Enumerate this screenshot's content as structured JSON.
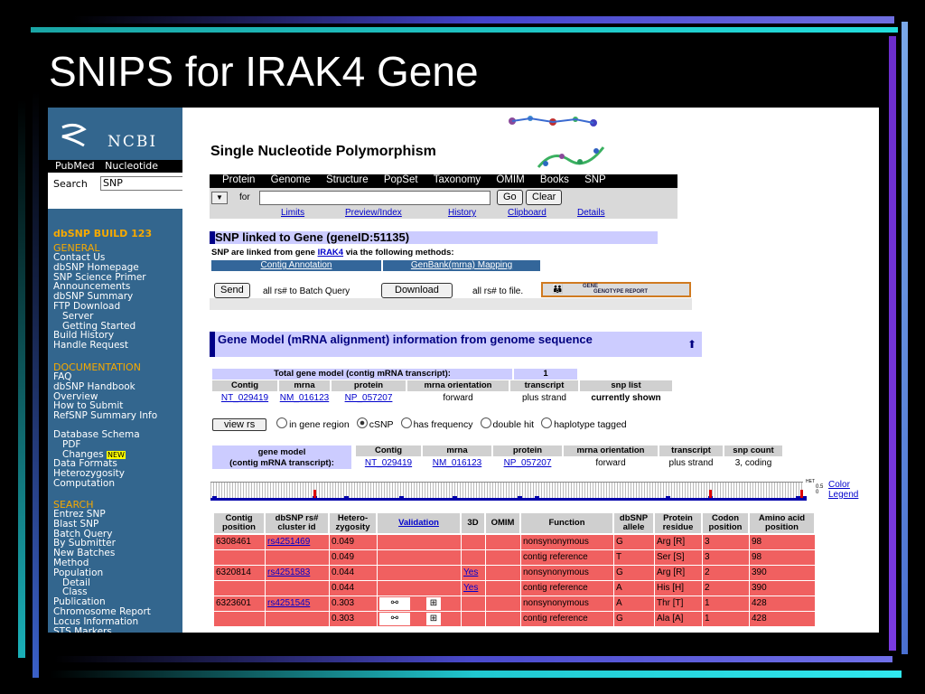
{
  "slide": {
    "title": "SNIPS for IRAK4 Gene"
  },
  "sidebar": {
    "logo": "NCBI",
    "top_links": [
      "PubMed",
      "Nucleotide"
    ],
    "search_label": "Search",
    "search_value": "SNP",
    "build": "dbSNP BUILD 123",
    "general_head": "GENERAL",
    "general": [
      "Contact Us",
      "dbSNP Homepage",
      "SNP Science Primer",
      "Announcements",
      "dbSNP Summary",
      "FTP Download",
      "Server",
      "Getting Started",
      "Build History",
      "Handle Request"
    ],
    "doc_head": "DOCUMENTATION",
    "docs": [
      "FAQ",
      "dbSNP Handbook",
      "Overview",
      "How to Submit",
      "RefSNP Summary Info",
      "Database Schema",
      "PDF",
      "Changes",
      "Data Formats",
      "Heterozygosity",
      "Computation"
    ],
    "new_badge": "NEW",
    "search_head": "SEARCH",
    "searches": [
      "Entrez SNP",
      "Blast SNP",
      "Batch Query",
      "By Submitter",
      "New Batches",
      "Method",
      "Population",
      "Detail",
      "Class",
      "Publication",
      "Chromosome Report",
      "Locus Information",
      "STS Markers"
    ]
  },
  "page": {
    "title": "Single Nucleotide Polymorphism",
    "nav": [
      "Protein",
      "Genome",
      "Structure",
      "PopSet",
      "Taxonomy",
      "OMIM",
      "Books",
      "SNP"
    ],
    "for_label": "for",
    "go": "Go",
    "clear": "Clear",
    "links": [
      "Limits",
      "Preview/Index",
      "History",
      "Clipboard",
      "Details"
    ]
  },
  "linked": {
    "heading": "SNP linked to Gene (geneID:51135)",
    "text_pre": "SNP are linked from gene ",
    "gene": "IRAK4",
    "text_post": " via the following methods:",
    "methods": [
      "Contig Annotation",
      "GenBank(mrna) Mapping"
    ],
    "send": "Send",
    "send_text": "all rs# to Batch Query",
    "download": "Download",
    "download_text": "all rs# to file.",
    "report_top": "GENE",
    "report_bottom": "GENOTYPE REPORT"
  },
  "gene_model": {
    "title": "Gene Model (mRNA alignment) information from genome sequence",
    "up": "⬆",
    "total_label": "Total gene model (contig mRNA transcript):",
    "total_value": "1",
    "headers": [
      "Contig",
      "mrna",
      "protein",
      "mrna orientation",
      "transcript",
      "snp list"
    ],
    "row": [
      "NT_029419",
      "NM_016123",
      "NP_057207",
      "forward",
      "plus strand",
      "currently shown"
    ]
  },
  "filters": {
    "view": "view rs",
    "options": [
      "in gene region",
      "cSNP",
      "has frequency",
      "double hit",
      "haplotype tagged"
    ],
    "selected": "cSNP"
  },
  "gene_model2": {
    "label1": "gene model",
    "label2": "(contig mRNA transcript):",
    "headers": [
      "Contig",
      "mrna",
      "protein",
      "mrna orientation",
      "transcript",
      "snp count"
    ],
    "row": [
      "NT_029419",
      "NM_016123",
      "NP_057207",
      "forward",
      "plus strand",
      "3, coding"
    ]
  },
  "track": {
    "ticks": [
      "HET",
      "0.5",
      "0"
    ],
    "legend1": "Color",
    "legend2": "Legend"
  },
  "snp_table": {
    "headers": [
      [
        "Contig",
        "position"
      ],
      [
        "dbSNP rs#",
        "cluster id"
      ],
      [
        "Hetero-",
        "zygosity"
      ],
      [
        "Validation",
        ""
      ],
      [
        "3D",
        ""
      ],
      [
        "OMIM",
        ""
      ],
      [
        "Function",
        ""
      ],
      [
        "dbSNP",
        "allele"
      ],
      [
        "Protein",
        "residue"
      ],
      [
        "Codon",
        "position"
      ],
      [
        "Amino acid",
        "position"
      ]
    ],
    "rows": [
      [
        "6308461",
        "rs4251469",
        "0.049",
        "",
        "",
        "",
        "nonsynonymous",
        "G",
        "Arg [R]",
        "3",
        "98"
      ],
      [
        "",
        "",
        "0.049",
        "",
        "",
        "",
        "contig reference",
        "T",
        "Ser [S]",
        "3",
        "98"
      ],
      [
        "6320814",
        "rs4251583",
        "0.044",
        "",
        "Yes",
        "",
        "nonsynonymous",
        "G",
        "Arg [R]",
        "2",
        "390"
      ],
      [
        "",
        "",
        "0.044",
        "",
        "Yes",
        "",
        "contig reference",
        "A",
        "His [H]",
        "2",
        "390"
      ],
      [
        "6323601",
        "rs4251545",
        "0.303",
        "",
        "",
        "",
        "nonsynonymous",
        "A",
        "Thr [T]",
        "1",
        "428"
      ],
      [
        "",
        "",
        "0.303",
        "",
        "",
        "",
        "contig reference",
        "G",
        "Ala [A]",
        "1",
        "428"
      ]
    ]
  },
  "colors": {
    "table_row": "#f06060",
    "sidebar": "#33668e",
    "header": "#cfcfcf",
    "section": "#ccccff"
  }
}
